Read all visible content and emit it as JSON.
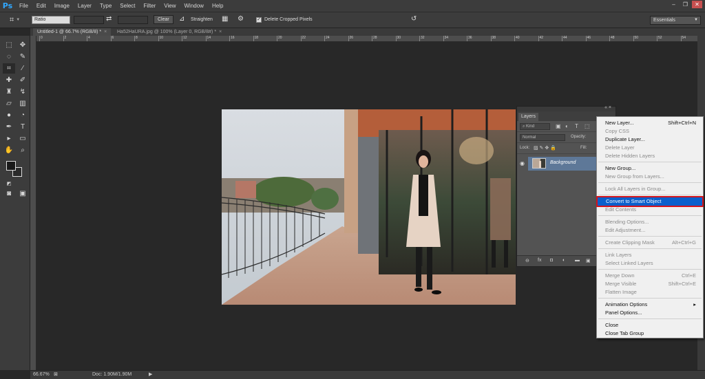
{
  "menubar": {
    "logo": "Ps",
    "items": [
      "File",
      "Edit",
      "Image",
      "Layer",
      "Type",
      "Select",
      "Filter",
      "View",
      "Window",
      "Help"
    ]
  },
  "options": {
    "ratio": "Ratio",
    "clear": "Clear",
    "straighten": "Straighten",
    "delete_cropped": "Delete Cropped Pixels",
    "workspace": "Essentials"
  },
  "tabs": [
    {
      "label": "Untitled-1 @ 66.7% (RGB/8) *"
    },
    {
      "label": "Ha52HaURA.jpg @ 100% (Layer 0, RGB/8#) *"
    }
  ],
  "ruler": [
    "0",
    "2",
    "4",
    "6",
    "8",
    "10",
    "12",
    "14",
    "16",
    "18",
    "20",
    "22",
    "24",
    "26",
    "28",
    "30",
    "32",
    "34",
    "36",
    "38",
    "40",
    "42",
    "44",
    "46",
    "48",
    "50",
    "52",
    "54"
  ],
  "status": {
    "zoom": "66.67%",
    "doc": "Doc: 1.90M/1.90M"
  },
  "layers": {
    "tab": "Layers",
    "kind": "Kind",
    "blend": "Normal",
    "opacity_label": "Opacity:",
    "lock_label": "Lock:",
    "fill_label": "Fill:",
    "layer_name": "Background"
  },
  "context_menu": [
    {
      "label": "New Layer...",
      "shortcut": "Shift+Ctrl+N",
      "enabled": true
    },
    {
      "label": "Copy CSS",
      "shortcut": "",
      "enabled": false
    },
    {
      "label": "Duplicate Layer...",
      "shortcut": "",
      "enabled": true
    },
    {
      "label": "Delete Layer",
      "shortcut": "",
      "enabled": false
    },
    {
      "label": "Delete Hidden Layers",
      "shortcut": "",
      "enabled": false
    },
    {
      "label": "New Group...",
      "shortcut": "",
      "enabled": true
    },
    {
      "label": "New Group from Layers...",
      "shortcut": "",
      "enabled": false
    },
    {
      "label": "Lock All Layers in Group...",
      "shortcut": "",
      "enabled": false
    },
    {
      "label": "Convert to Smart Object",
      "shortcut": "",
      "enabled": true,
      "highlighted": true
    },
    {
      "label": "Edit Contents",
      "shortcut": "",
      "enabled": false
    },
    {
      "label": "Blending Options...",
      "shortcut": "",
      "enabled": false
    },
    {
      "label": "Edit Adjustment...",
      "shortcut": "",
      "enabled": false
    },
    {
      "label": "Create Clipping Mask",
      "shortcut": "Alt+Ctrl+G",
      "enabled": false
    },
    {
      "label": "Link Layers",
      "shortcut": "",
      "enabled": false
    },
    {
      "label": "Select Linked Layers",
      "shortcut": "",
      "enabled": false
    },
    {
      "label": "Merge Down",
      "shortcut": "Ctrl+E",
      "enabled": false
    },
    {
      "label": "Merge Visible",
      "shortcut": "Shift+Ctrl+E",
      "enabled": false
    },
    {
      "label": "Flatten Image",
      "shortcut": "",
      "enabled": false
    },
    {
      "label": "Animation Options",
      "shortcut": "▸",
      "enabled": true
    },
    {
      "label": "Panel Options...",
      "shortcut": "",
      "enabled": true
    },
    {
      "label": "Close",
      "shortcut": "",
      "enabled": true
    },
    {
      "label": "Close Tab Group",
      "shortcut": "",
      "enabled": true
    }
  ],
  "colors": {
    "accent": "#0b5fcc",
    "highlight_border": "#d4141c",
    "ps_blue": "#31a8ff"
  }
}
